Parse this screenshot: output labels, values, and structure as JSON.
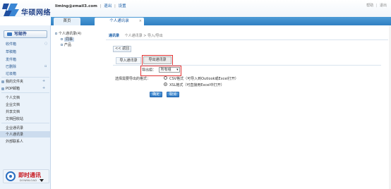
{
  "header": {
    "brand": "华硕网络",
    "account": "liming@zmail3.com",
    "exit_link": "退出",
    "settings_link": "设置",
    "right_links": [
      "帮助",
      "退出"
    ]
  },
  "tabs": [
    {
      "label": "首页"
    },
    {
      "label": "个人通讯录"
    }
  ],
  "sidebar": {
    "write_label": "写邮件",
    "folders": [
      "收件箱",
      "草稿箱",
      "发件箱",
      "已删除",
      "垃圾箱"
    ],
    "groups": [
      "我的文件夹",
      "POP邮箱"
    ],
    "docs": [
      "个人文档",
      "企业文档",
      "共享文档",
      "文档回收站"
    ],
    "contacts": [
      "企业通讯录",
      "个人通讯录",
      "外部联系人"
    ]
  },
  "promo": {
    "title": "即时通讯",
    "sub": "DOWNLOAD"
  },
  "tree": {
    "root": "个人通讯录(4)",
    "children": [
      "同事",
      "产品"
    ]
  },
  "breadcrumb": {
    "head": "通讯录",
    "path": "个人通讯录 > 导入/导出"
  },
  "back_label": "<< 返回",
  "import_tab": "导入通讯录",
  "export_tab": "导出通讯录",
  "export_group_label": "导出组：",
  "export_group_value": "所有组",
  "format_prompt": "选择需要导出的格式：",
  "format_options": [
    {
      "label": "CSV格式（可导入到Outlook或Excel打开）",
      "selected": false
    },
    {
      "label": "XSL格式（可直接用Excel中打开）",
      "selected": true
    }
  ],
  "buttons": {
    "ok": "确定",
    "cancel": "取消"
  }
}
